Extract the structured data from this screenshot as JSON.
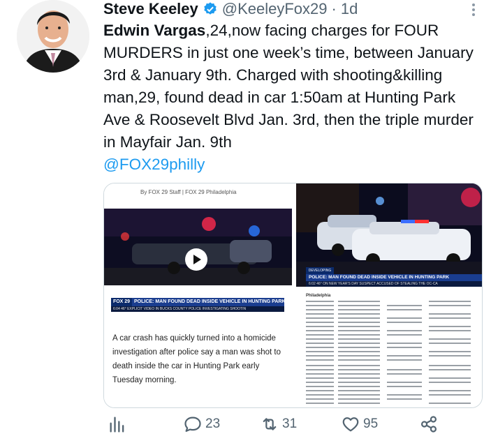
{
  "tweet": {
    "author_name": "Steve Keeley",
    "handle": "@KeeleyFox29",
    "separator": "·",
    "time": "1d",
    "text_lead": "Edwin Vargas",
    "text_body": ",24,now facing charges for FOUR MURDERS in just one week’s time, between January 3rd & January 9th.   Charged with shooting&killing man,29, found dead in car 1:50am at Hunting Park Ave & Roosevelt Blvd Jan. 3rd, then the triple murder in Mayfair Jan. 9th",
    "mention": "@FOX29philly"
  },
  "media": {
    "left": {
      "byline": "By FOX 29 Staff | FOX 29 Philadelphia",
      "lower_logo": "FOX 29",
      "lower_headline": "POLICE: MAN FOUND DEAD INSIDE VEHICLE IN HUNTING PARK",
      "lower_ticker": "6:04  46°  EXPLICIT VIDEO IN BUCKS COUNTY   POLICE INVESTIGATING SHOOTIN",
      "article_text": "A car crash has quickly turned into a homicide investigation after police say a man was shot to death inside the car in Hunting Park early Tuesday morning."
    },
    "top_right": {
      "logo": "DEVELOPING STORY",
      "headline": "POLICE: MAN FOUND DEAD INSIDE VEHICLE IN HUNTING PARK",
      "ticker": "6:02  46°  ON NEW YEAR'S DAY   SUSPECT ACCUSED OF STEALING THE OC-CA"
    },
    "bottom_right": {
      "title": "Philadelphia"
    }
  },
  "actions": {
    "views_icon": "bar-chart-icon",
    "replies_icon": "reply-bubble-icon",
    "replies": "23",
    "retweets_icon": "retweet-icon",
    "retweets": "31",
    "likes_icon": "heart-icon",
    "likes": "95",
    "share_icon": "share-icon"
  },
  "colors": {
    "link": "#1d9bf0",
    "verified": "#1d9bf0",
    "muted": "#536471",
    "text": "#0f1419"
  }
}
